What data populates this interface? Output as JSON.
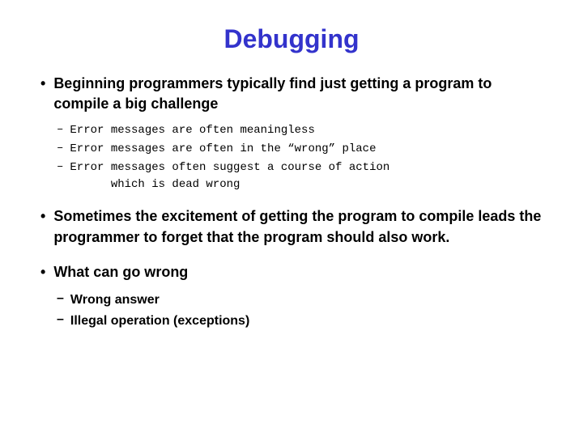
{
  "title": "Debugging",
  "bullets": [
    {
      "id": "bullet1",
      "text": "Beginning programmers typically find just getting a program to compile a big challenge",
      "subitems": [
        {
          "id": "sub1a",
          "text": "Error messages are often meaningless"
        },
        {
          "id": "sub1b",
          "text": "Error messages are often in the “wrong” place"
        },
        {
          "id": "sub1c",
          "text": "Error messages often suggest a course of action\n        which is dead wrong"
        }
      ]
    },
    {
      "id": "bullet2",
      "text": "Sometimes the excitement of getting the program to compile leads the programmer to forget that the program should also work.",
      "subitems": []
    },
    {
      "id": "bullet3",
      "text": "What can go wrong",
      "subitems": [
        {
          "id": "sub3a",
          "text": "Wrong answer"
        },
        {
          "id": "sub3b",
          "text": "Illegal operation (exceptions)"
        }
      ]
    }
  ],
  "sub1_lines": [
    "Error messages are often meaningless",
    "Error messages are often in the “wrong” place",
    "Error messages often suggest a course of action",
    "      which is dead wrong"
  ],
  "sub3_lines": [
    "Wrong answer",
    "Illegal operation (exceptions)"
  ]
}
